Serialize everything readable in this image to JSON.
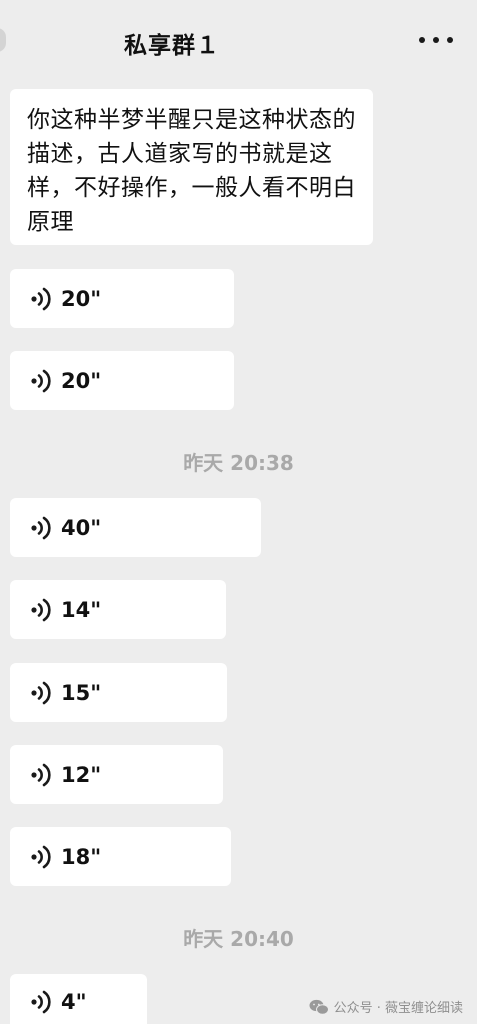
{
  "header": {
    "title": "私享群１",
    "more_icon": "more-dots-icon"
  },
  "messages": {
    "text_message": "你这种半梦半醒只是这种状态的描述，古人道家写的书就是这样，不好操作，一般人看不明白原理",
    "voice_1": "20\"",
    "voice_2": "20\"",
    "time_1": "昨天 20:38",
    "voice_3": "40\"",
    "voice_4": "14\"",
    "voice_5": "15\"",
    "voice_6": "12\"",
    "voice_7": "18\"",
    "time_2": "昨天 20:40",
    "voice_8": "4\""
  },
  "watermark": {
    "text": "公众号 · 薇宝缠论细读",
    "icon": "wechat-icon"
  },
  "colors": {
    "background": "#ededed",
    "bubble": "#ffffff",
    "time_text": "#a9a9a9"
  }
}
